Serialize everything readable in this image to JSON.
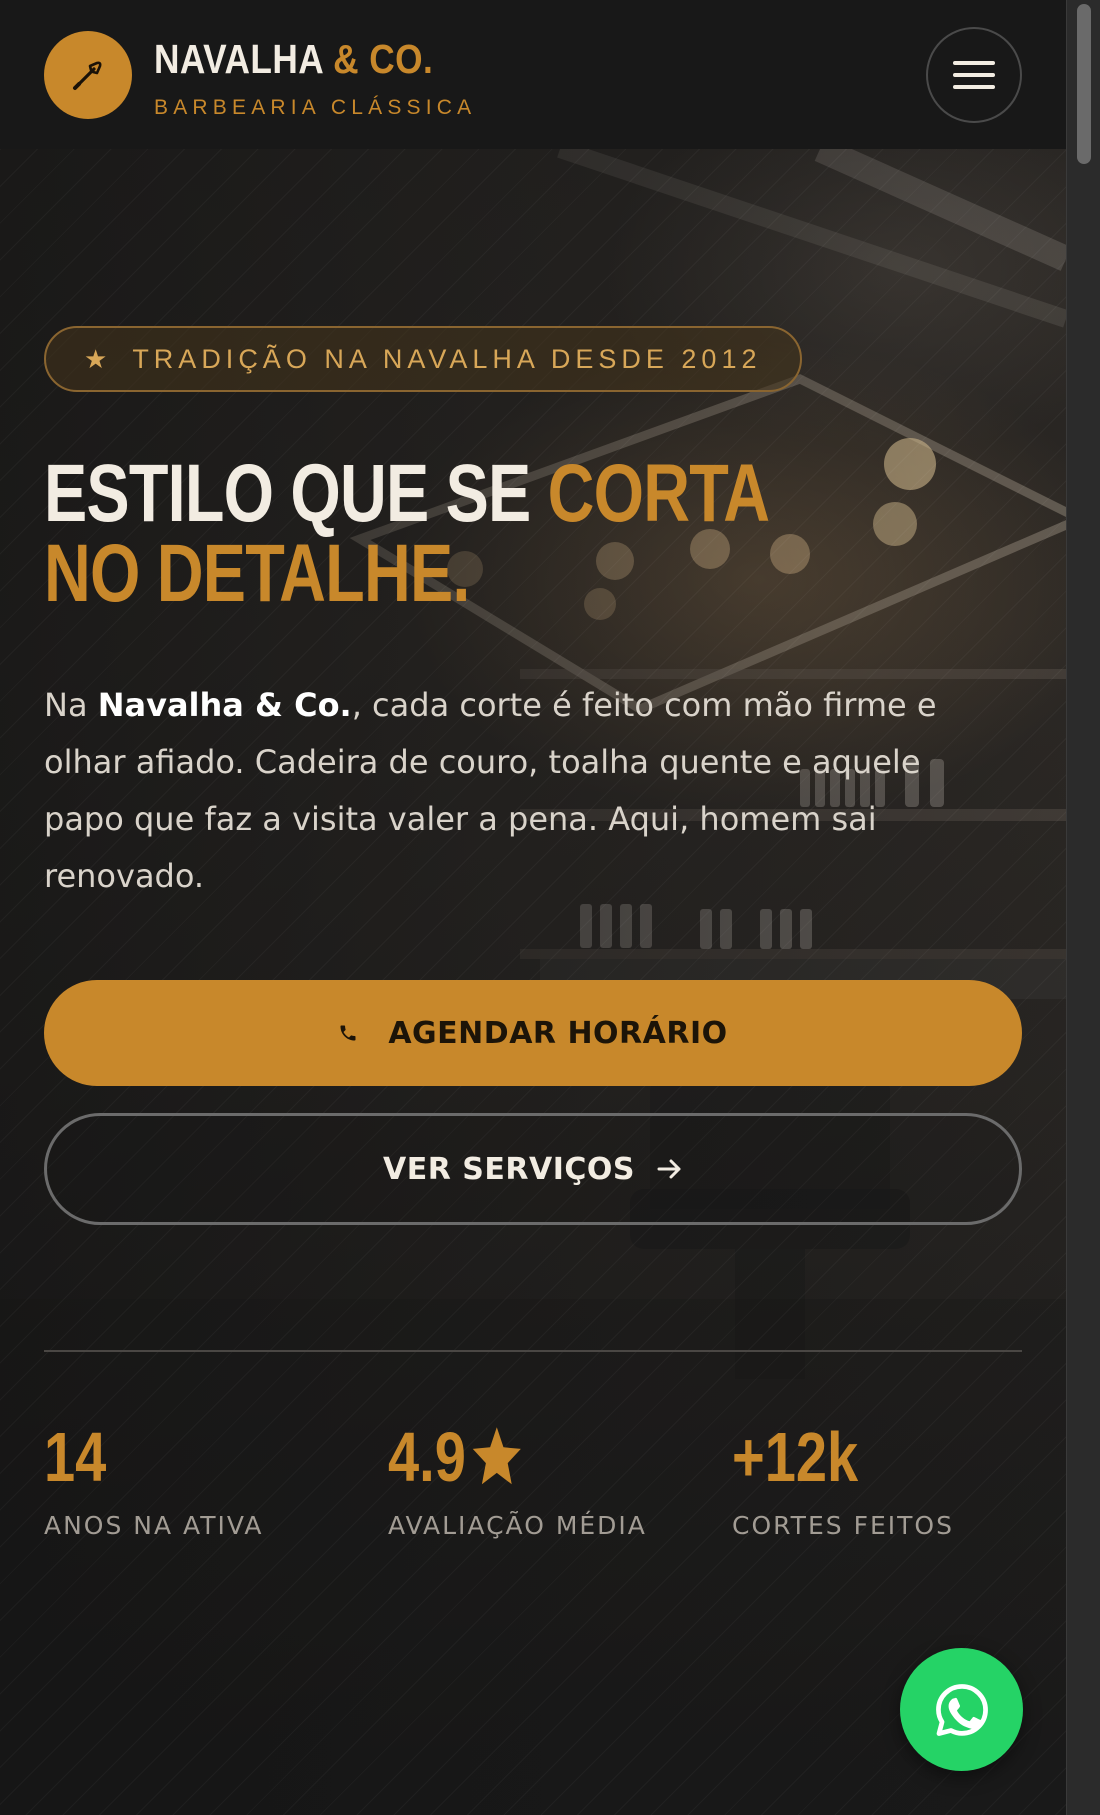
{
  "header": {
    "brand_main": "NAVALHA",
    "brand_accent": "& CO.",
    "tagline": "BARBEARIA CLÁSSICA",
    "logo_icon": "razor-icon",
    "menu_icon": "hamburger-icon"
  },
  "hero": {
    "badge": "TRADIÇÃO NA NAVALHA DESDE 2012",
    "badge_icon": "star-icon",
    "title_main": "ESTILO QUE SE ",
    "title_accent": "CORTA NO DETALHE.",
    "intro_prefix": "Na ",
    "intro_brand": "Navalha & Co.",
    "intro_text": ", cada corte é feito com mão firme e olhar afiado. Cadeira de couro, toalha quente e aquele papo que faz a visita valer a pena. Aqui, homem sai renovado.",
    "primary_cta": "AGENDAR HORÁRIO",
    "primary_cta_icon": "phone-icon",
    "secondary_cta": "VER SERVIÇOS",
    "secondary_cta_icon": "arrow-right-icon"
  },
  "stats": [
    {
      "value": "14",
      "label": "ANOS NA ATIVA"
    },
    {
      "value": "4.9",
      "label": "AVALIAÇÃO MÉDIA",
      "icon": "star-icon"
    },
    {
      "value": "+12k",
      "label": "CORTES FEITOS"
    }
  ],
  "floating": {
    "whatsapp_icon": "whatsapp-icon"
  },
  "colors": {
    "accent": "#c8882b",
    "background": "#1c1c1c",
    "header_background": "#181818",
    "text_light": "#f2ece2",
    "whatsapp": "#25d366"
  }
}
